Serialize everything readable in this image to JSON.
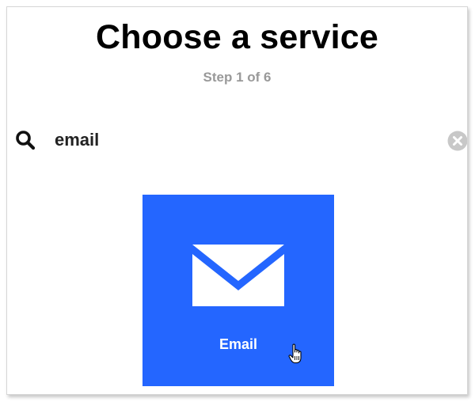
{
  "header": {
    "title": "Choose a service",
    "step": "Step 1 of 6"
  },
  "search": {
    "value": "email",
    "search_icon": "search-icon",
    "clear_icon": "clear-icon"
  },
  "results": [
    {
      "label": "Email",
      "icon": "envelope-icon",
      "color": "#2466ff"
    }
  ],
  "colors": {
    "tile_background": "#2466ff",
    "step_text": "#999999",
    "clear_icon": "#c8c8c8"
  }
}
